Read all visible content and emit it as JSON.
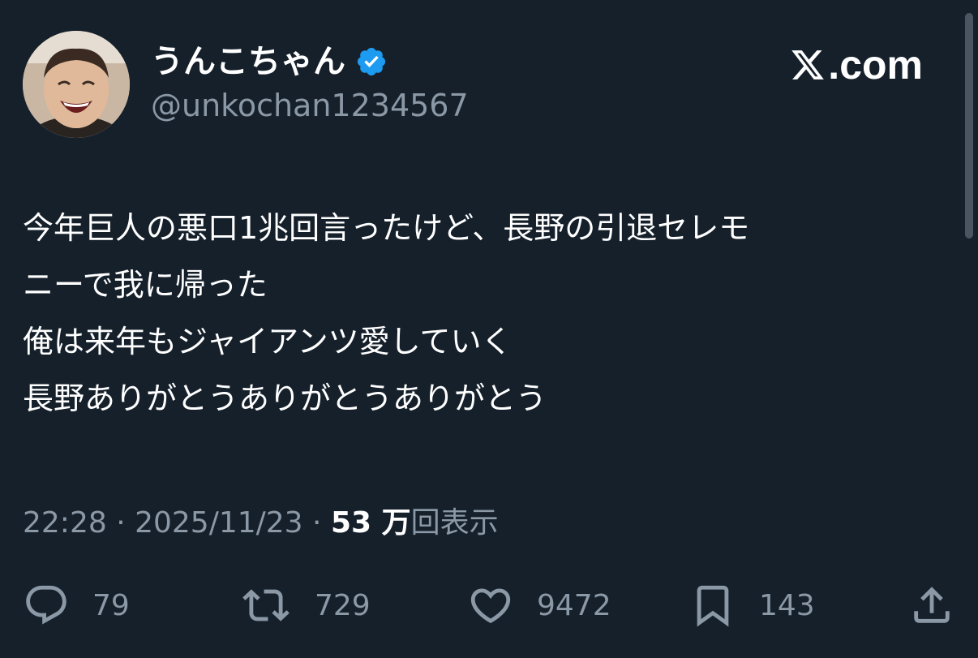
{
  "user": {
    "display_name": "うんこちゃん",
    "handle": "@unkochan1234567",
    "verified": true
  },
  "brand": {
    "logo_text": ".com",
    "logo_icon": "x-logo-icon"
  },
  "post": {
    "lines": [
      "今年巨人の悪口1兆回言ったけど、長野の引退セレモ",
      "ニーで我に帰った",
      "俺は来年もジャイアンツ愛していく",
      "長野ありがとうありがとうありがとう"
    ]
  },
  "meta": {
    "time": "22:28",
    "separator": " · ",
    "date": "2025/11/23",
    "views_count": "53 万",
    "views_label": "回表示"
  },
  "actions": {
    "replies": "79",
    "reposts": "729",
    "likes": "9472",
    "bookmarks": "143"
  },
  "colors": {
    "background": "#15202b",
    "secondary_text": "#8b98a5",
    "verified_blue": "#1d9bf0"
  }
}
